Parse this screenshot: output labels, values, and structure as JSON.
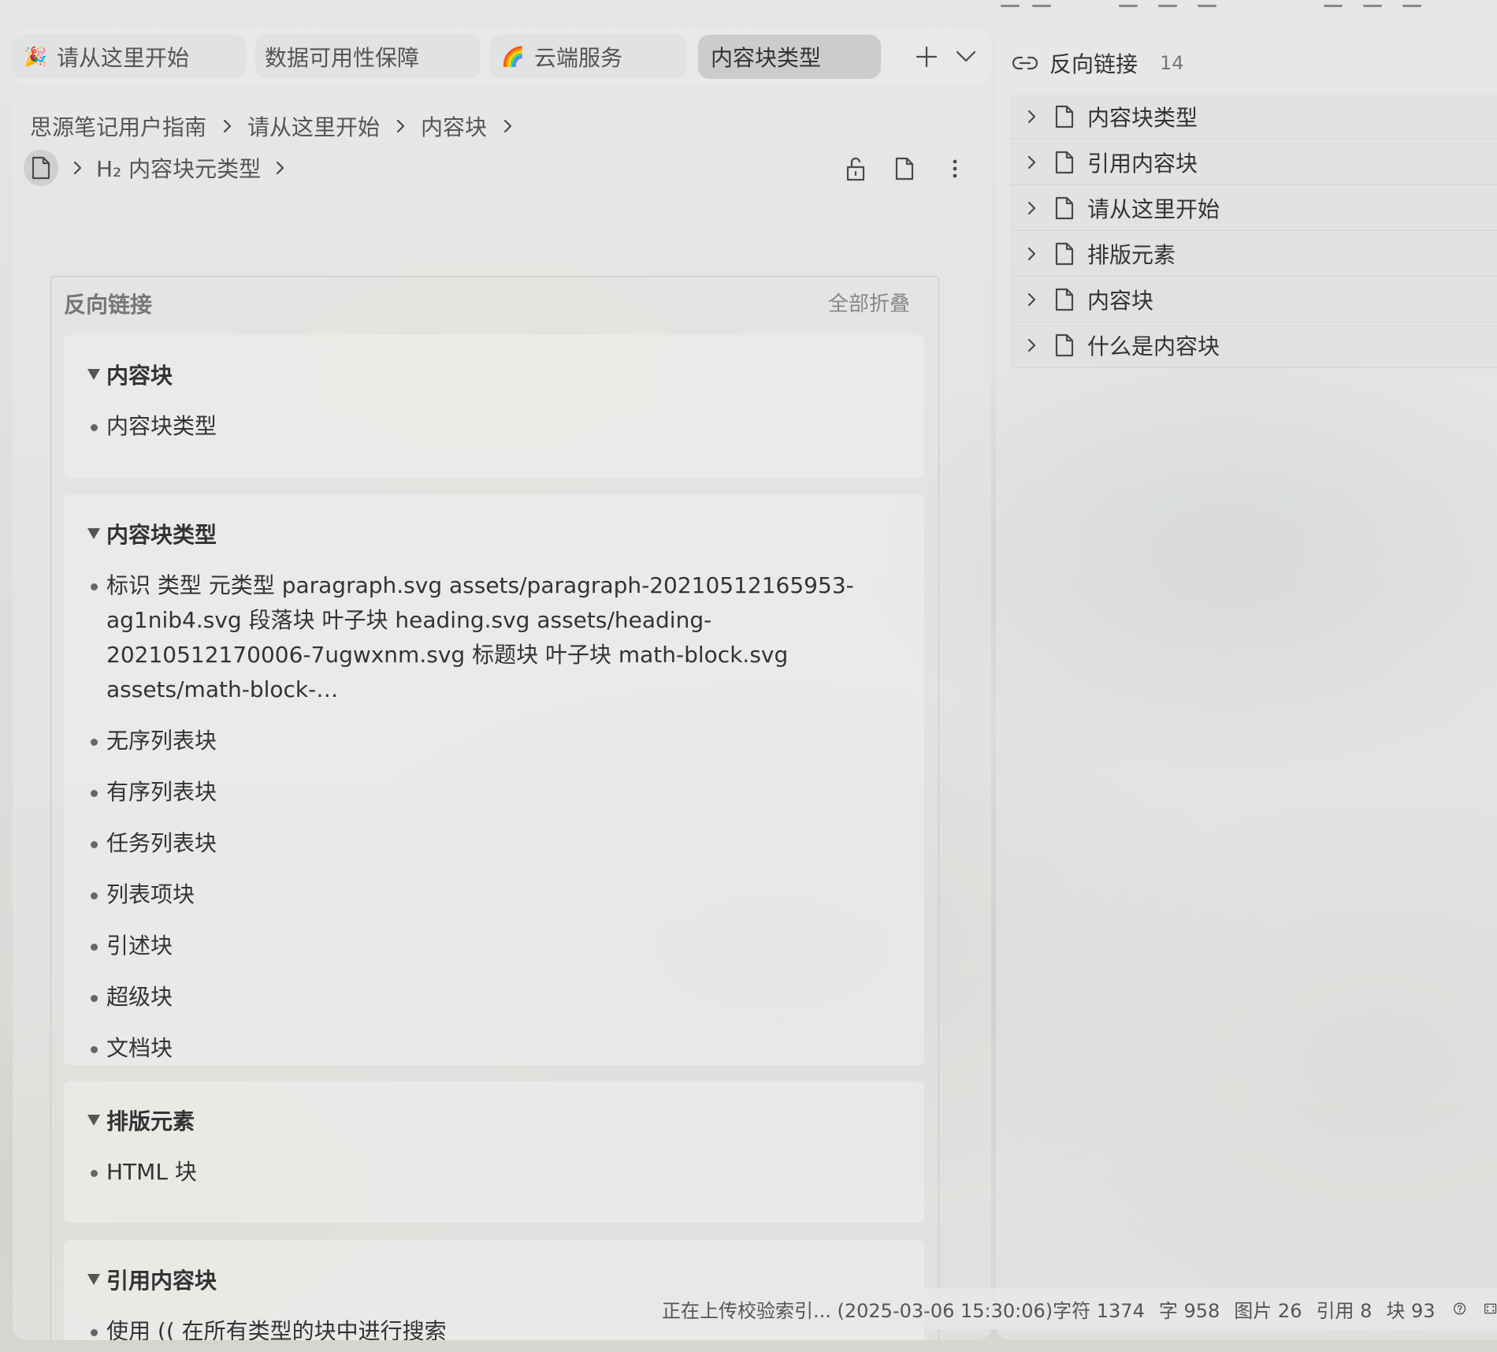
{
  "tabs": [
    {
      "label": "请从这里开始",
      "emoji": "🎉"
    },
    {
      "label": "数据可用性保障",
      "emoji": ""
    },
    {
      "label": "云端服务",
      "emoji": "🌈"
    },
    {
      "label": "内容块类型",
      "emoji": "",
      "active": true
    }
  ],
  "breadcrumb": {
    "items": [
      "思源笔记用户指南",
      "请从这里开始",
      "内容块"
    ],
    "heading": "H₂ 内容块元类型"
  },
  "backlinks_panel": {
    "title": "反向链接",
    "collapse_all": "全部折叠",
    "groups": [
      {
        "title": "内容块",
        "items": [
          "内容块类型"
        ]
      },
      {
        "title": "内容块类型",
        "items": [
          "标识 类型 元类型 paragraph.svg assets/paragraph-20210512165953-ag1nib4.svg 段落块 叶子块 heading.svg assets/heading-20210512170006-7ugwxnm.svg 标题块 叶子块 math-block.svg assets/math-block-…",
          "无序列表块",
          "有序列表块",
          "任务列表块",
          "列表项块",
          "引述块",
          "超级块",
          "文档块"
        ]
      },
      {
        "title": "排版元素",
        "items": [
          "HTML 块"
        ]
      },
      {
        "title": "引用内容块",
        "items": [
          "使用 (( 在所有类型的块中进行搜索"
        ]
      }
    ]
  },
  "right_panel": {
    "title": "反向链接",
    "count": "14",
    "items": [
      "内容块类型",
      "引用内容块",
      "请从这里开始",
      "排版元素",
      "内容块",
      "什么是内容块"
    ]
  },
  "status": {
    "message": "正在上传校验索引... (2025-03-06 15:30:06)",
    "chars": "字符 1374",
    "words": "字 958",
    "images": "图片 26",
    "refs": "引用 8",
    "blocks": "块 93"
  },
  "icons": {
    "tab_add": "plus-icon",
    "tab_more": "chevron-down-icon",
    "lock": "unlock-icon",
    "doc": "file-icon",
    "more": "more-vertical-icon",
    "link": "link-icon",
    "help": "help-icon",
    "layout": "layout-icon"
  }
}
